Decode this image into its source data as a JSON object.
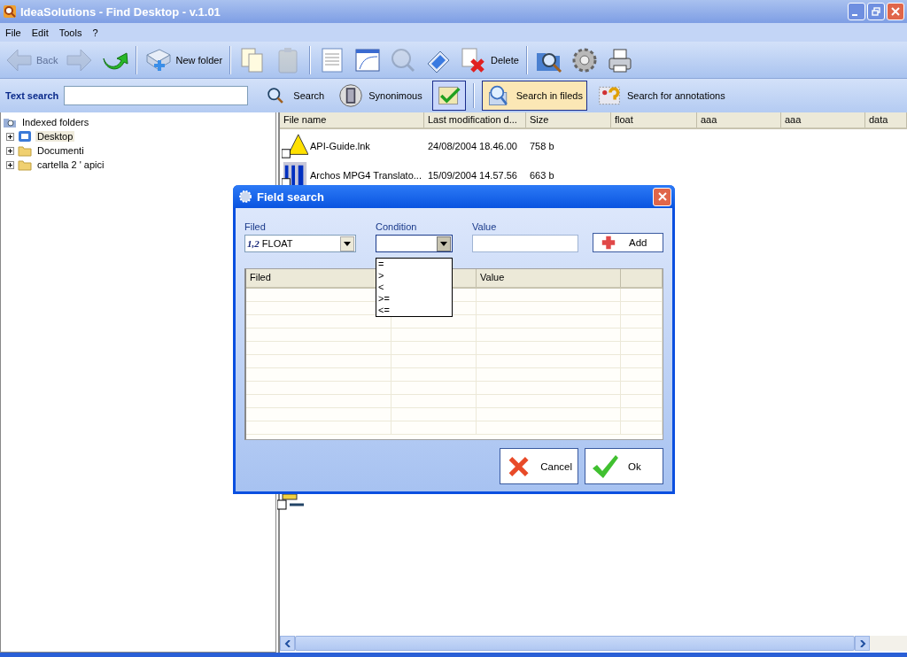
{
  "window": {
    "title": "IdeaSolutions - Find Desktop - v.1.01"
  },
  "menu": [
    "File",
    "Edit",
    "Tools",
    "?"
  ],
  "toolbar": {
    "groups": [
      [
        {
          "label": "Back",
          "disabled": true
        },
        {
          "disabled": true
        },
        {
          "disabled": false
        }
      ],
      [
        {
          "label": "New folder",
          "disabled": false
        }
      ],
      [
        {
          "disabled": false
        },
        {
          "disabled": true
        }
      ],
      [
        {
          "disabled": false
        },
        {
          "disabled": false
        },
        {
          "disabled": true
        },
        {
          "disabled": false
        },
        {
          "label": "Delete",
          "disabled": false
        }
      ],
      [
        {
          "disabled": false
        },
        {
          "disabled": false
        },
        {
          "disabled": false
        }
      ]
    ]
  },
  "search_bar": {
    "label": "Text search",
    "buttons": [
      {
        "label": "Search",
        "selected": false
      },
      {
        "label": "Synonimous",
        "selected": false
      },
      {
        "selected": true
      },
      {
        "label": "Search in fileds",
        "selected": true
      },
      {
        "label": "Search for annotations",
        "selected": false
      }
    ]
  },
  "tree": {
    "label": "Indexed folders",
    "children": [
      {
        "label": "Desktop",
        "expanded": false,
        "selected": true
      },
      {
        "label": "Documenti",
        "expanded": false,
        "selected": false
      },
      {
        "label": "cartella 2 ' apici",
        "expanded": false,
        "selected": false
      }
    ]
  },
  "table": {
    "columns": [
      "File name",
      "Last modification d...",
      "Size",
      "float",
      "aaa",
      "aaa",
      "data"
    ],
    "rows": [
      {
        "name": "API-Guide.lnk",
        "modified": "24/08/2004 18.46.00",
        "size": "758 b"
      },
      {
        "name": "Archos MPG4 Translato...",
        "modified": "15/09/2004 14.57.56",
        "size": "663 b"
      }
    ]
  },
  "dialog": {
    "title": "Field search",
    "filed": {
      "label": "Filed",
      "prefix": "1,2",
      "value": "FLOAT"
    },
    "condition": {
      "label": "Condition",
      "expanded": true,
      "options": [
        "=",
        ">",
        "<",
        ">=",
        "<="
      ]
    },
    "value": {
      "label": "Value"
    },
    "add_button": "Add",
    "table_columns": [
      "Filed",
      "Value"
    ],
    "buttons": [
      "Cancel",
      "Ok"
    ]
  }
}
